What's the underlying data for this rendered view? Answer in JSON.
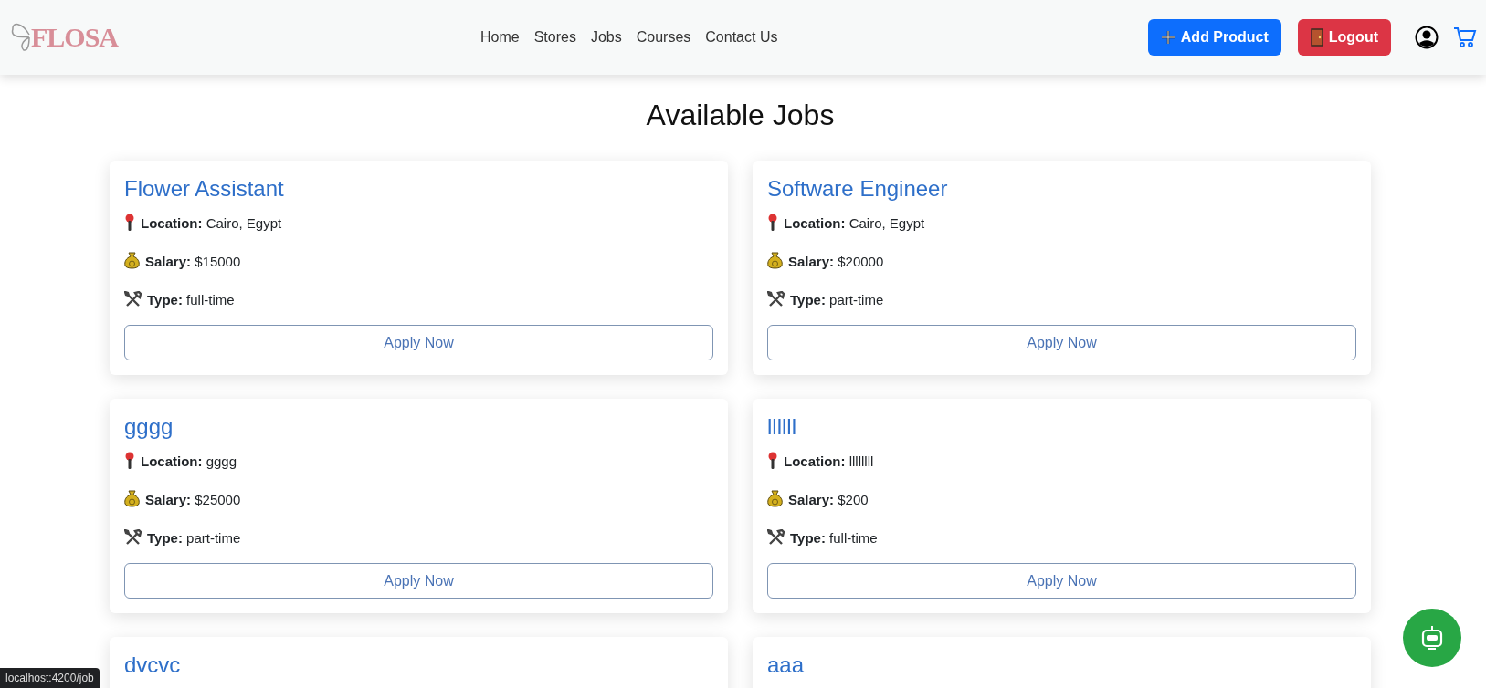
{
  "navbar": {
    "logo": "FLOSA",
    "links": [
      {
        "label": "Home"
      },
      {
        "label": "Stores"
      },
      {
        "label": "Jobs"
      },
      {
        "label": "Courses"
      },
      {
        "label": "Contact Us"
      }
    ],
    "add_product_button": "Add Product",
    "logout_button": "Logout"
  },
  "heading": "Available Jobs",
  "jobs": [
    {
      "title": "Flower Assistant",
      "location_label": "Location:",
      "location": "Cairo, Egypt",
      "salary_label": "Salary:",
      "salary": "$15000",
      "type_label": "Type:",
      "type": "full-time",
      "button": "Apply Now"
    },
    {
      "title": "Software Engineer",
      "location_label": "Location:",
      "location": "Cairo, Egypt",
      "salary_label": "Salary:",
      "salary": "$20000",
      "type_label": "Type:",
      "type": "part-time",
      "button": "Apply Now"
    },
    {
      "title": "gggg",
      "location_label": "Location:",
      "location": "gggg",
      "salary_label": "Salary:",
      "salary": "$25000",
      "type_label": "Type:",
      "type": "part-time",
      "button": "Apply Now"
    },
    {
      "title": "llllll",
      "location_label": "Location:",
      "location": "llllllll",
      "salary_label": "Salary:",
      "salary": "$200",
      "type_label": "Type:",
      "type": "full-time",
      "button": "Apply Now"
    },
    {
      "title": "dvcvc"
    },
    {
      "title": "aaa"
    }
  ],
  "status_bar": {
    "url": "localhost:4200/job"
  }
}
